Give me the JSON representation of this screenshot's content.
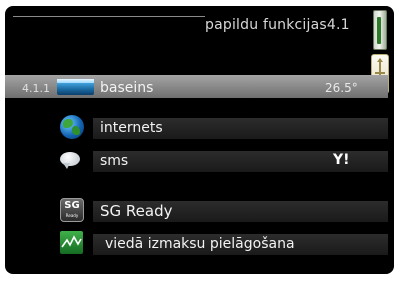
{
  "header": {
    "title": "papildu funkcijas",
    "menu_number": "4.1"
  },
  "menu": {
    "items": [
      {
        "number": "4.1.1",
        "label": "baseins",
        "value": "26.5°",
        "icon": "pool-icon",
        "selected": true
      },
      {
        "number": "",
        "label": "internets",
        "value": "",
        "icon": "globe-icon",
        "selected": false
      },
      {
        "number": "",
        "label": "sms",
        "value": "",
        "icon": "sms-icon",
        "status_icon": "signal-icon",
        "status_text": "Y!",
        "selected": false
      },
      {
        "number": "",
        "label": "SG Ready",
        "value": "",
        "icon": "sg-ready-icon",
        "icon_text": "SG",
        "icon_subtext": "Ready",
        "selected": false
      },
      {
        "number": "",
        "label": "viedā izmaksu pielāgošana",
        "value": "",
        "icon": "price-chart-icon",
        "selected": false
      }
    ]
  },
  "colors": {
    "background": "#000000",
    "selected_row": "#8a8a8a",
    "row": "#222222",
    "text": "#f3f3f3"
  }
}
